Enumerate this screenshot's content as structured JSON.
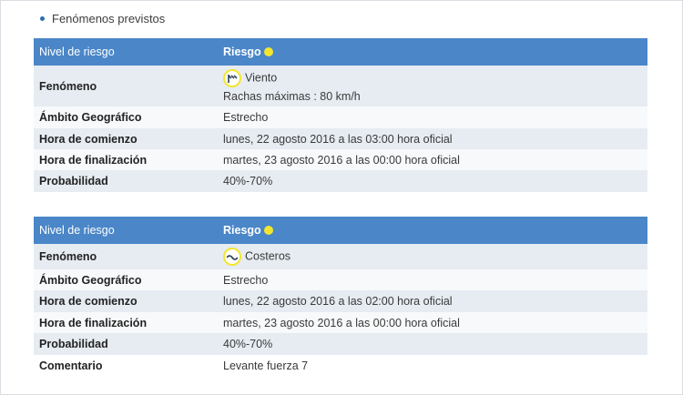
{
  "section": {
    "title": "Fenómenos previstos"
  },
  "warnings": [
    {
      "header": {
        "key": "Nivel de riesgo",
        "value": "Riesgo"
      },
      "risk_color": "#f2e630",
      "phenomenon": {
        "label": "Fenómeno",
        "icon": "wind-icon",
        "name": "Viento",
        "detail": "Rachas máximas : 80 km/h"
      },
      "scope": {
        "label": "Ámbito Geográfico",
        "value": "Estrecho"
      },
      "start": {
        "label": "Hora de comienzo",
        "value": "lunes, 22 agosto 2016 a las 03:00 hora oficial"
      },
      "end": {
        "label": "Hora de finalización",
        "value": "martes, 23 agosto 2016 a las 00:00 hora oficial"
      },
      "probability": {
        "label": "Probabilidad",
        "value": "40%-70%"
      }
    },
    {
      "header": {
        "key": "Nivel de riesgo",
        "value": "Riesgo"
      },
      "risk_color": "#f2e630",
      "phenomenon": {
        "label": "Fenómeno",
        "icon": "coastal-waves-icon",
        "name": "Costeros"
      },
      "scope": {
        "label": "Ámbito Geográfico",
        "value": "Estrecho"
      },
      "start": {
        "label": "Hora de comienzo",
        "value": "lunes, 22 agosto 2016 a las 02:00 hora oficial"
      },
      "end": {
        "label": "Hora de finalización",
        "value": "martes, 23 agosto 2016 a las 00:00 hora oficial"
      },
      "probability": {
        "label": "Probabilidad",
        "value": "40%-70%"
      },
      "comment": {
        "label": "Comentario",
        "value": "Levante fuerza 7"
      }
    }
  ]
}
